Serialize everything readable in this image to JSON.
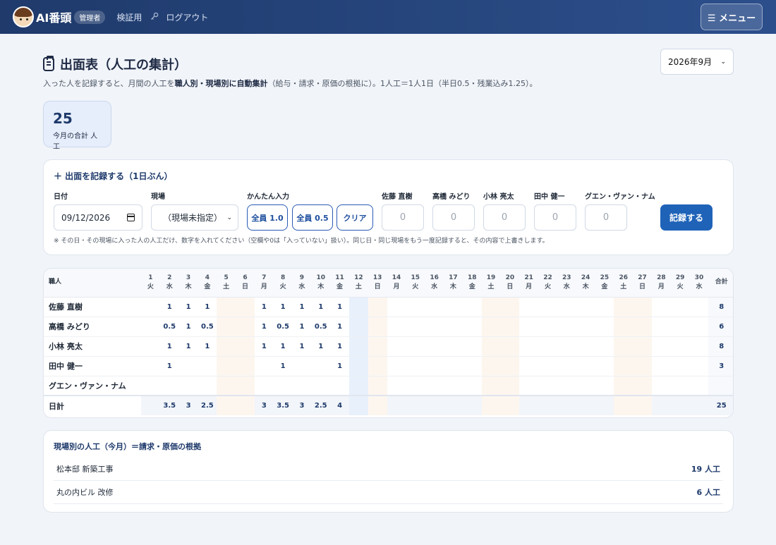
{
  "header": {
    "brand": "AI番頭",
    "role": "管理者",
    "nav_verify": "検証用",
    "nav_logout": "ログアウト",
    "menu_label": "☰ メニュー"
  },
  "page": {
    "title": "出面表（人工の集計）",
    "subtitle_pre": "入った人を記録すると、月間の人工を",
    "subtitle_bold": "職人別・現場別に自動集計",
    "subtitle_post": "（給与・請求・原価の根拠に）。1人工＝1人1日（半日0.5・残業込み1.25）。",
    "month_selected": "2026年9月"
  },
  "summary": {
    "total": "25",
    "total_label": "今月の合計 人工"
  },
  "entry": {
    "title": "＋ 出面を記録する（1日ぶん）",
    "date_label": "日付",
    "date_value": "09/12/2026",
    "site_label": "現場",
    "site_value": "（現場未指定）",
    "quick_label": "かんたん入力",
    "btn_all_1": "全員 1.0",
    "btn_all_05": "全員 0.5",
    "btn_clear": "クリア",
    "workers": [
      "佐藤 直樹",
      "高橋 みどり",
      "小林 亮太",
      "田中 健一",
      "グエン・ヴァン・ナム"
    ],
    "input_placeholder": "0",
    "submit": "記録する",
    "note": "※ その日・その現場に入った人の人工だけ、数字を入れてください（空欄や0は「入っていない」扱い）。同じ日・同じ現場をもう一度記録すると、その内容で上書きします。"
  },
  "table": {
    "name_header": "職人",
    "total_header": "合計",
    "days": [
      "1",
      "2",
      "3",
      "4",
      "5",
      "6",
      "7",
      "8",
      "9",
      "10",
      "11",
      "12",
      "13",
      "14",
      "15",
      "16",
      "17",
      "18",
      "19",
      "20",
      "21",
      "22",
      "23",
      "24",
      "25",
      "26",
      "27",
      "28",
      "29",
      "30"
    ],
    "weekdays": [
      "火",
      "水",
      "木",
      "金",
      "土",
      "日",
      "月",
      "火",
      "水",
      "木",
      "金",
      "土",
      "日",
      "月",
      "火",
      "水",
      "木",
      "金",
      "土",
      "日",
      "月",
      "火",
      "水",
      "木",
      "金",
      "土",
      "日",
      "月",
      "火",
      "水"
    ],
    "weekend_days": [
      5,
      6,
      13,
      19,
      20,
      26,
      27
    ],
    "today_day": 12,
    "rows": [
      {
        "name": "佐藤 直樹",
        "values": {
          "2": "1",
          "3": "1",
          "4": "1",
          "7": "1",
          "8": "1",
          "9": "1",
          "10": "1",
          "11": "1"
        },
        "total": "8"
      },
      {
        "name": "高橋 みどり",
        "values": {
          "2": "0.5",
          "3": "1",
          "4": "0.5",
          "7": "1",
          "8": "0.5",
          "9": "1",
          "10": "0.5",
          "11": "1"
        },
        "total": "6"
      },
      {
        "name": "小林 亮太",
        "values": {
          "2": "1",
          "3": "1",
          "4": "1",
          "7": "1",
          "8": "1",
          "9": "1",
          "10": "1",
          "11": "1"
        },
        "total": "8"
      },
      {
        "name": "田中 健一",
        "values": {
          "2": "1",
          "8": "1",
          "11": "1"
        },
        "total": "3"
      },
      {
        "name": "グエン・ヴァン・ナム",
        "values": {},
        "total": ""
      }
    ],
    "footer_label": "日計",
    "footer_values": {
      "2": "3.5",
      "3": "3",
      "4": "2.5",
      "7": "3",
      "8": "3.5",
      "9": "3",
      "10": "2.5",
      "11": "4"
    },
    "footer_total": "25"
  },
  "sites": {
    "title": "現場別の人工（今月）＝請求・原価の根拠",
    "rows": [
      {
        "name": "松本邸 新築工事",
        "value": "19 人工"
      },
      {
        "name": "丸の内ビル 改修",
        "value": "6 人工"
      }
    ]
  }
}
